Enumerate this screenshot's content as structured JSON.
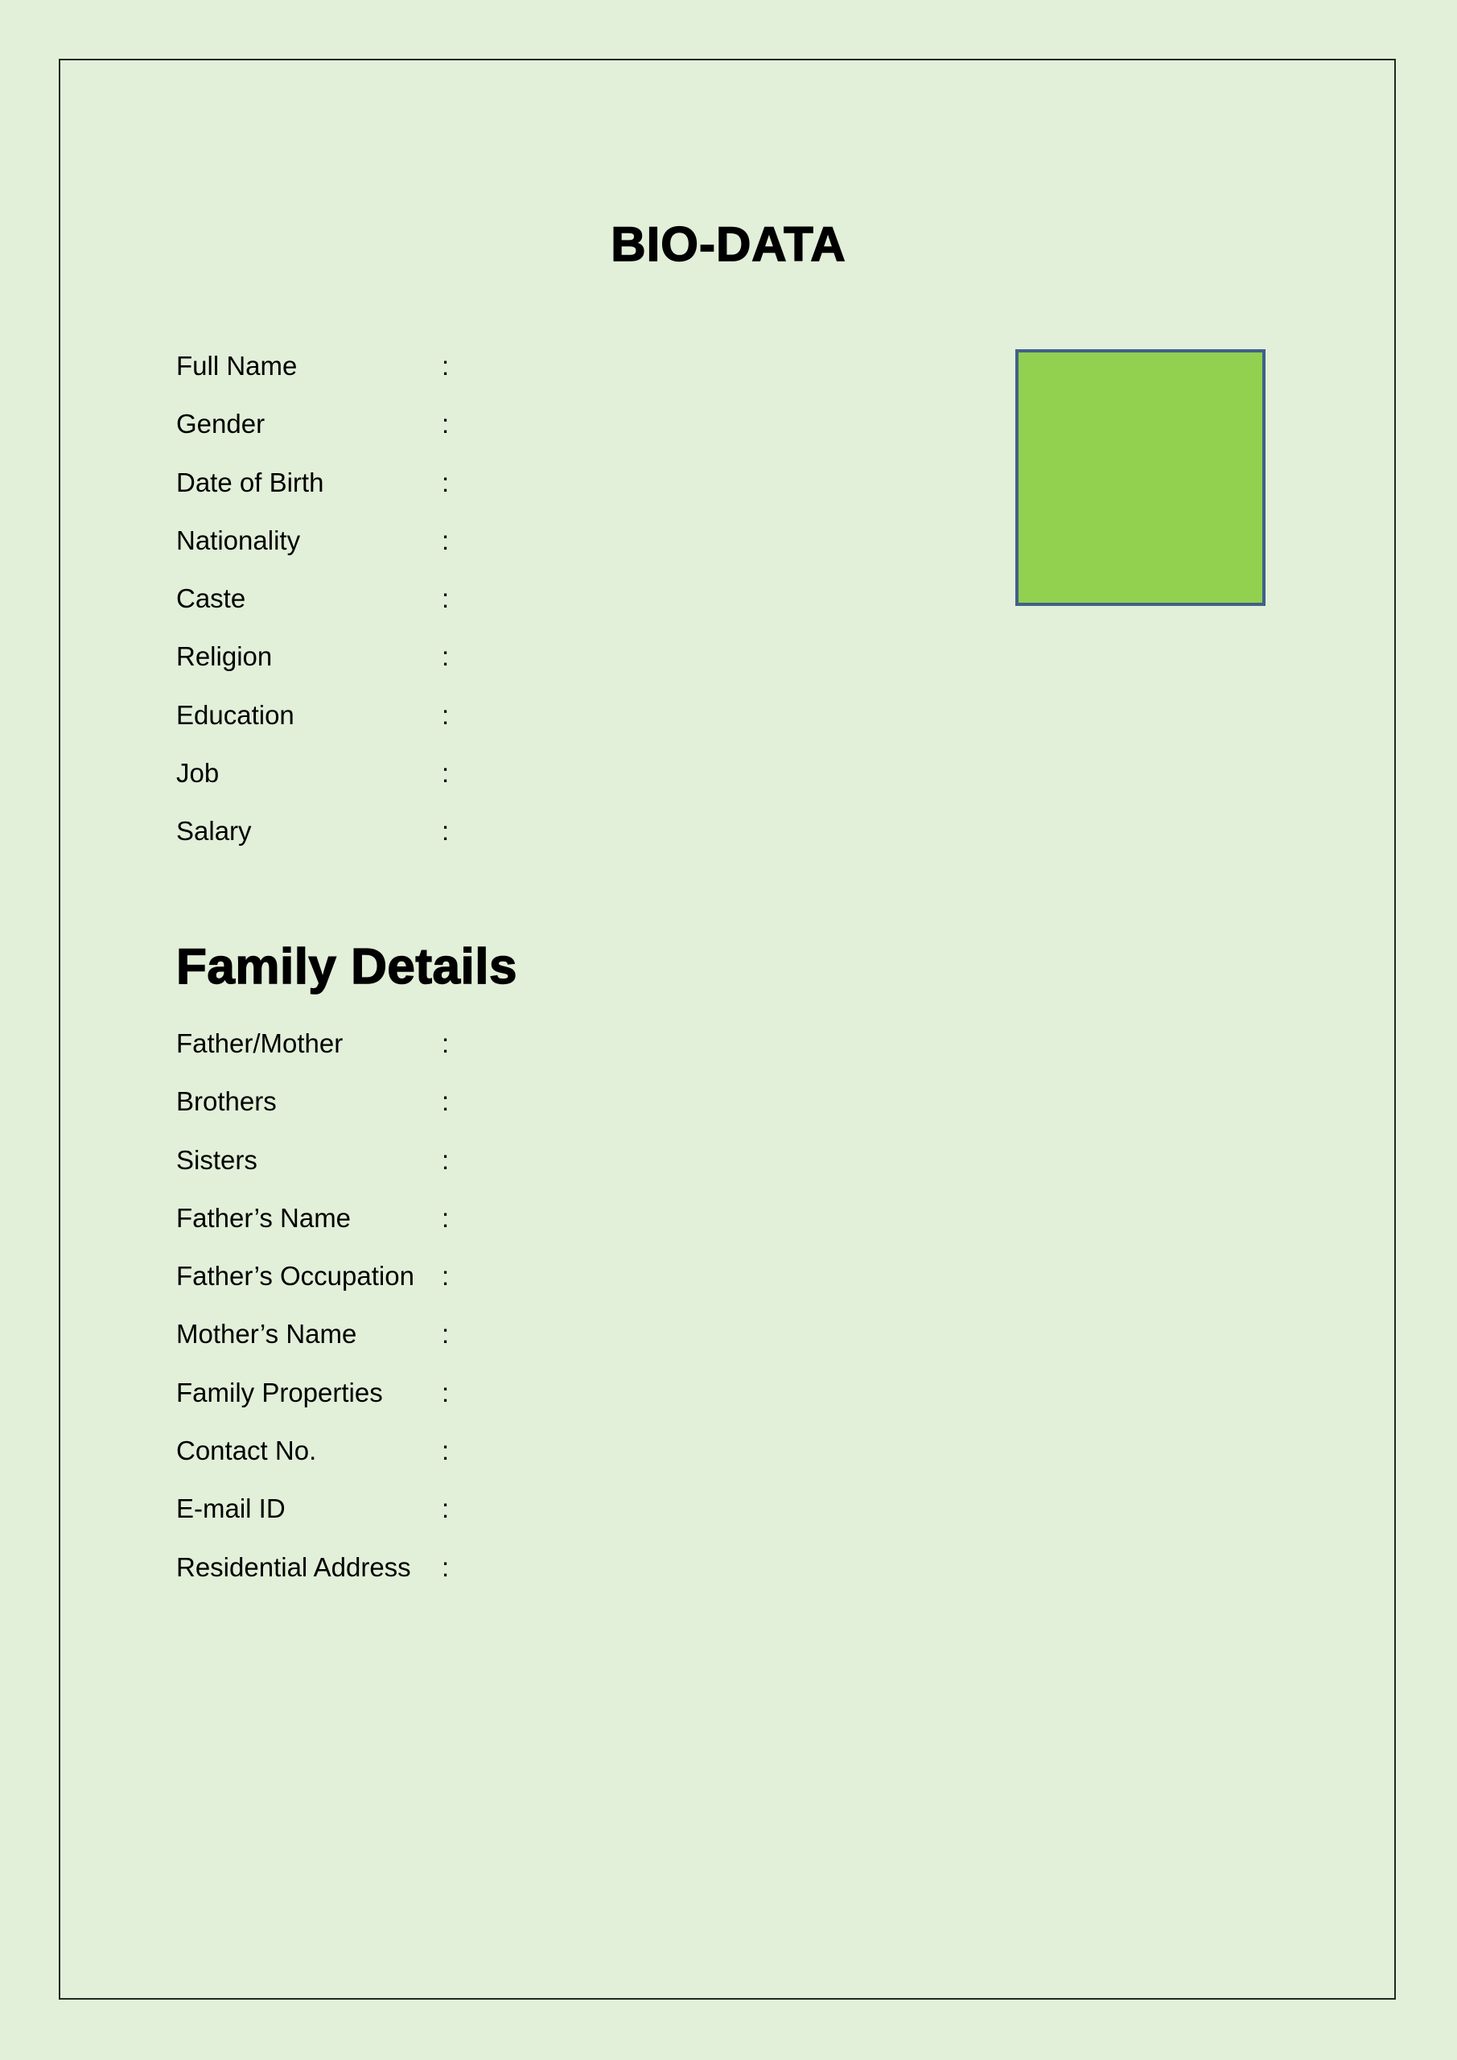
{
  "document": {
    "title": "BIO-DATA",
    "background_color": "#e2efd9",
    "photo_placeholder": {
      "fill_color": "#92d050",
      "border_color": "#41608a"
    }
  },
  "personal_details": {
    "fields": [
      {
        "label": "Full Name",
        "separator": ":",
        "value": ""
      },
      {
        "label": "Gender",
        "separator": ":",
        "value": ""
      },
      {
        "label": "Date of Birth",
        "separator": ":",
        "value": ""
      },
      {
        "label": "Nationality",
        "separator": ":",
        "value": ""
      },
      {
        "label": "Caste",
        "separator": ":",
        "value": ""
      },
      {
        "label": "Religion",
        "separator": ":",
        "value": ""
      },
      {
        "label": "Education",
        "separator": ":",
        "value": ""
      },
      {
        "label": "Job",
        "separator": ":",
        "value": ""
      },
      {
        "label": "Salary",
        "separator": ":",
        "value": ""
      }
    ]
  },
  "family_details": {
    "heading": "Family Details",
    "fields": [
      {
        "label": "Father/Mother",
        "separator": ":",
        "value": ""
      },
      {
        "label": "Brothers",
        "separator": ":",
        "value": ""
      },
      {
        "label": "Sisters",
        "separator": ":",
        "value": ""
      },
      {
        "label": "Father’s Name",
        "separator": ":",
        "value": ""
      },
      {
        "label": "Father’s Occupation",
        "separator": ":",
        "value": ""
      },
      {
        "label": "Mother’s Name",
        "separator": ":",
        "value": ""
      },
      {
        "label": "Family Properties",
        "separator": ":",
        "value": ""
      },
      {
        "label": "Contact No.",
        "separator": ":",
        "value": ""
      },
      {
        "label": "E-mail ID",
        "separator": ":",
        "value": ""
      },
      {
        "label": "Residential Address",
        "separator": ":",
        "value": ""
      }
    ]
  }
}
